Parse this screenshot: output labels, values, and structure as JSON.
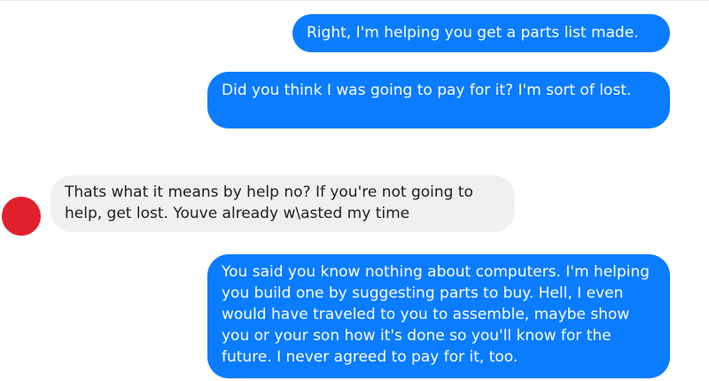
{
  "thread": {
    "messages": [
      {
        "direction": "outgoing",
        "text": "Right, I'm helping you get a parts list made."
      },
      {
        "direction": "outgoing",
        "text": "Did you think I was going to pay for it? I'm sort of lost."
      },
      {
        "direction": "incoming",
        "text": "Thats what it means by help no? If you're not going to help, get lost. Youve already w\\asted my time"
      },
      {
        "direction": "outgoing",
        "text": "You said you know nothing about computers. I'm helping you build one by suggesting parts to buy. Hell, I even would have traveled to you to assemble, maybe show you or your son how it's done so you'll know for the future. I never agreed to pay for it, too."
      }
    ]
  },
  "colors": {
    "outgoing_bubble": "#0a7cff",
    "incoming_bubble": "#f1f0f0",
    "avatar": "#e0202a"
  },
  "icons": {
    "contact_avatar": "avatar-icon"
  }
}
